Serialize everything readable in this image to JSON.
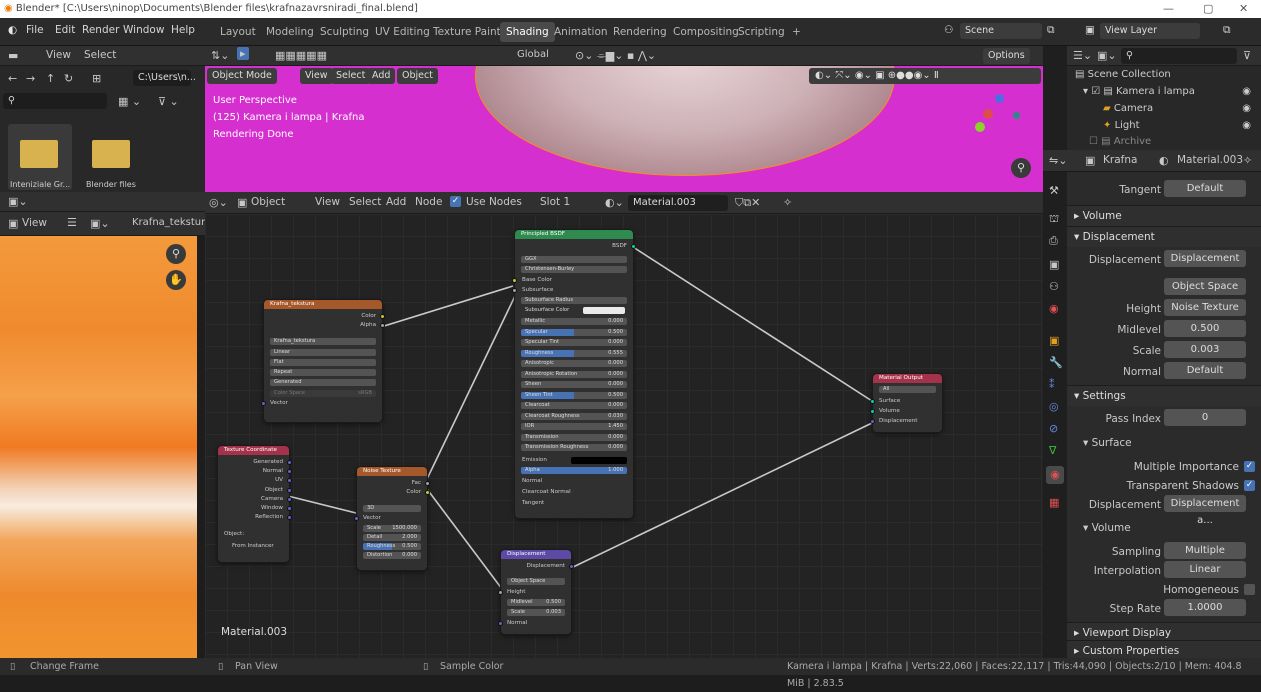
{
  "title_bar": {
    "text": "Blender* [C:\\Users\\ninop\\Documents\\Blender files\\krafnazavrsniradi_final.blend]"
  },
  "menu": [
    "File",
    "Edit",
    "Render",
    "Window",
    "Help"
  ],
  "workspace_tabs": [
    "Layout",
    "Modeling",
    "Sculpting",
    "UV Editing",
    "Texture Paint",
    "Shading",
    "Animation",
    "Rendering",
    "Compositing",
    "Scripting",
    "+"
  ],
  "active_tab": "Shading",
  "scene": {
    "label": "Scene"
  },
  "view_layer": {
    "label": "View Layer"
  },
  "file_browser": {
    "view_label": "View",
    "select_label": "Select",
    "path": "C:\\Users\\n...",
    "folders": [
      "Inteniziale Gr...",
      "Blender files"
    ]
  },
  "viewport": {
    "mode": "Object Mode",
    "menus": [
      "View",
      "Select",
      "Add",
      "Object"
    ],
    "transform": "Global",
    "options": "Options",
    "info_lines": [
      "User Perspective",
      "(125) Kamera i lampa | Krafna",
      "Rendering Done"
    ]
  },
  "image_editor": {
    "view_label": "View",
    "image_name": "Krafna_tekstura"
  },
  "node_header": {
    "object_label": "Object",
    "menus": [
      "View",
      "Select",
      "Add",
      "Node"
    ],
    "use_nodes": "Use Nodes",
    "slot": "Slot 1",
    "material": "Material.003"
  },
  "material_name_label": "Material.003",
  "nodes": {
    "image_texture": {
      "title": "Krafna_tekstura",
      "outputs": [
        "Color",
        "Alpha"
      ],
      "image": "Krafna_tekstura",
      "fields": [
        "Linear",
        "Flat",
        "Repeat",
        "Generated"
      ],
      "color_space": "Color Space",
      "color_space_value": "sRGB",
      "input": "Vector"
    },
    "texture_coordinate": {
      "title": "Texture Coordinate",
      "outputs": [
        "Generated",
        "Normal",
        "UV",
        "Object",
        "Camera",
        "Window",
        "Reflection"
      ],
      "object_label": "Object:",
      "from_instancer": "From Instancer"
    },
    "noise_texture": {
      "title": "Noise Texture",
      "outputs": [
        "Fac",
        "Color"
      ],
      "dim": "3D",
      "input": "Vector",
      "params": [
        [
          "Scale",
          "1500.000"
        ],
        [
          "Detail",
          "2.000"
        ],
        [
          "Roughness",
          "0.500"
        ],
        [
          "Distortion",
          "0.000"
        ]
      ]
    },
    "principled": {
      "title": "Principled BSDF",
      "output": "BSDF",
      "dist": "GGX",
      "sss": "Christensen-Burley",
      "base_color": "Base Color",
      "subsurface": "Subsurface",
      "subsurface_radius": "Subsurface Radius",
      "subsurface_color": "Subsurface Color",
      "params": [
        [
          "Metallic",
          "0.000"
        ],
        [
          "Specular",
          "0.500"
        ],
        [
          "Specular Tint",
          "0.000"
        ],
        [
          "Roughness",
          "0.555"
        ],
        [
          "Anisotropic",
          "0.000"
        ],
        [
          "Anisotropic Rotation",
          "0.000"
        ],
        [
          "Sheen",
          "0.000"
        ],
        [
          "Sheen Tint",
          "0.500"
        ],
        [
          "Clearcoat",
          "0.000"
        ],
        [
          "Clearcoat Roughness",
          "0.030"
        ],
        [
          "IOR",
          "1.450"
        ],
        [
          "Transmission",
          "0.000"
        ],
        [
          "Transmission Roughness",
          "0.000"
        ]
      ],
      "emission": "Emission",
      "alpha": [
        "Alpha",
        "1.000"
      ],
      "tail": [
        "Normal",
        "Clearcoat Normal",
        "Tangent"
      ]
    },
    "displacement": {
      "title": "Displacement",
      "output": "Displacement",
      "space": "Object Space",
      "height": "Height",
      "params": [
        [
          "Midlevel",
          "0.500"
        ],
        [
          "Scale",
          "0.003"
        ]
      ],
      "normal": "Normal"
    },
    "material_output": {
      "title": "Material Output",
      "target": "All",
      "inputs": [
        "Surface",
        "Volume",
        "Displacement"
      ]
    }
  },
  "outliner": {
    "root": "Scene Collection",
    "items": [
      "Kamera i lampa",
      "Camera",
      "Light",
      "Archive"
    ]
  },
  "properties": {
    "object": "Krafna",
    "material": "Material.003",
    "tangent_label": "Tangent",
    "tangent_value": "Default",
    "volume_section": "Volume",
    "displacement_section": "Displacement",
    "disp_label": "Displacement",
    "disp_value": "Displacement",
    "space_value": "Object Space",
    "height_label": "Height",
    "height_value": "Noise Texture",
    "midlevel_label": "Midlevel",
    "midlevel_value": "0.500",
    "scale_label": "Scale",
    "scale_value": "0.003",
    "normal_label": "Normal",
    "normal_value": "Default",
    "settings_section": "Settings",
    "pass_index_label": "Pass Index",
    "pass_index_value": "0",
    "surface_section": "Surface",
    "multiple_importance": "Multiple Importance",
    "transparent_shadows": "Transparent Shadows",
    "disp2_label": "Displacement",
    "disp2_value": "Displacement a...",
    "volume2_section": "Volume",
    "sampling_label": "Sampling",
    "sampling_value": "Multiple Importa...",
    "interp_label": "Interpolation",
    "interp_value": "Linear",
    "homogeneous": "Homogeneous",
    "step_label": "Step Rate",
    "step_value": "1.0000",
    "viewport_display": "Viewport Display",
    "custom_props": "Custom Properties"
  },
  "status_bar": {
    "left": "Change Frame",
    "mid": "Pan View",
    "mid2": "Sample Color",
    "right": "Kamera i lampa | Krafna | Verts:22,060 | Faces:22,117 | Tris:44,090 | Objects:2/10 | Mem: 404.8 MiB | 2.83.5"
  },
  "colors": {
    "accent": "#4772b3",
    "viewport_bg": "#d62fcf",
    "image_orange": "#f08a32"
  }
}
